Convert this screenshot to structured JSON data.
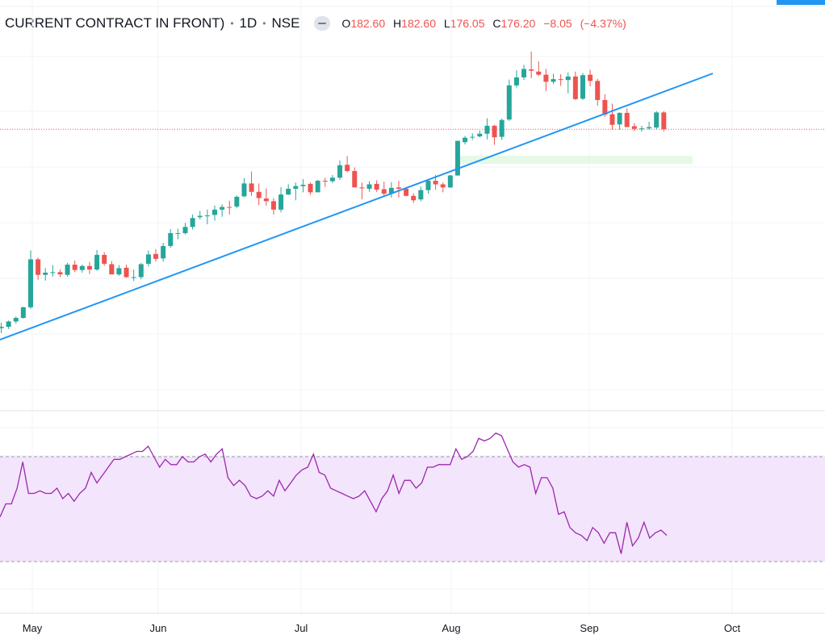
{
  "header": {
    "symbol_title": "CURRENT CONTRACT IN FRONT)",
    "interval": "1D",
    "exchange": "NSE",
    "ohlc": {
      "open_label": "O",
      "open": "182.60",
      "high_label": "H",
      "high": "182.60",
      "low_label": "L",
      "low": "176.05",
      "close_label": "C",
      "close": "176.20",
      "change": "−8.05",
      "change_pct": "(−4.37%)"
    }
  },
  "colors": {
    "up": "#26a69a",
    "down": "#ef5350",
    "trendline": "#2196f3",
    "rsi_line": "#9c27b0",
    "rsi_band": "#f3e5fb",
    "zone": "#e6f9e6",
    "grid": "#f0f3fa"
  },
  "chart_data": [
    {
      "type": "candlestick",
      "x_ticks": [
        "May",
        "Jun",
        "Jul",
        "Aug",
        "Sep",
        "Oct"
      ],
      "candles": [
        [
          119.7,
          120.9,
          118.6,
          120.0
        ],
        [
          120.0,
          121.4,
          119.5,
          121.2
        ],
        [
          121.2,
          122.3,
          120.7,
          122.0
        ],
        [
          122.0,
          124.5,
          121.8,
          124.4
        ],
        [
          124.4,
          137.2,
          124.0,
          135.2
        ],
        [
          135.2,
          135.6,
          130.6,
          131.7
        ],
        [
          131.7,
          133.2,
          130.4,
          132.2
        ],
        [
          132.2,
          133.9,
          131.3,
          132.3
        ],
        [
          132.3,
          132.9,
          131.2,
          131.8
        ],
        [
          131.7,
          134.4,
          131.3,
          134.0
        ],
        [
          134.0,
          134.9,
          132.3,
          132.8
        ],
        [
          132.8,
          134.0,
          132.2,
          133.7
        ],
        [
          133.7,
          134.6,
          131.9,
          132.9
        ],
        [
          132.9,
          137.3,
          132.6,
          136.2
        ],
        [
          136.2,
          136.8,
          133.7,
          134.2
        ],
        [
          134.1,
          134.8,
          131.8,
          131.8
        ],
        [
          131.8,
          133.9,
          131.5,
          133.2
        ],
        [
          133.3,
          134.0,
          131.0,
          131.2
        ],
        [
          131.2,
          132.9,
          130.3,
          131.2
        ],
        [
          131.2,
          134.4,
          130.7,
          134.1
        ],
        [
          134.2,
          137.2,
          133.6,
          136.3
        ],
        [
          136.4,
          137.5,
          134.7,
          135.3
        ],
        [
          135.4,
          138.9,
          134.7,
          138.2
        ],
        [
          138.2,
          142.0,
          137.8,
          141.1
        ],
        [
          141.1,
          142.1,
          139.7,
          141.1
        ],
        [
          141.1,
          143.4,
          140.8,
          142.5
        ],
        [
          142.5,
          145.3,
          141.9,
          144.5
        ],
        [
          144.7,
          146.1,
          144.2,
          145.0
        ],
        [
          145.0,
          146.4,
          143.1,
          145.1
        ],
        [
          145.2,
          147.3,
          143.9,
          146.4
        ],
        [
          146.4,
          147.6,
          144.8,
          147.0
        ],
        [
          147.0,
          148.4,
          145.3,
          146.9
        ],
        [
          147.1,
          149.6,
          146.7,
          149.3
        ],
        [
          149.4,
          153.5,
          149.2,
          152.3
        ],
        [
          152.3,
          155.0,
          149.5,
          150.4
        ],
        [
          150.4,
          152.3,
          147.4,
          149.0
        ],
        [
          148.9,
          151.2,
          147.3,
          148.3
        ],
        [
          148.3,
          149.0,
          145.3,
          146.4
        ],
        [
          146.4,
          151.5,
          145.8,
          149.8
        ],
        [
          149.8,
          152.1,
          149.7,
          151.1
        ],
        [
          151.1,
          152.5,
          148.5,
          151.7
        ],
        [
          151.7,
          153.3,
          150.3,
          152.0
        ],
        [
          152.2,
          152.5,
          149.7,
          150.3
        ],
        [
          150.3,
          153.1,
          150.4,
          152.9
        ],
        [
          152.9,
          153.6,
          151.5,
          152.8
        ],
        [
          152.8,
          154.2,
          152.4,
          153.6
        ],
        [
          153.6,
          157.5,
          153.1,
          156.4
        ],
        [
          156.5,
          158.5,
          154.8,
          155.1
        ],
        [
          155.1,
          155.9,
          151.6,
          151.4
        ],
        [
          151.4,
          152.5,
          148.7,
          151.2
        ],
        [
          151.1,
          152.8,
          150.4,
          152.1
        ],
        [
          152.2,
          153.0,
          150.4,
          150.9
        ],
        [
          151.0,
          152.7,
          149.4,
          150.0
        ],
        [
          150.0,
          152.6,
          149.1,
          151.3
        ],
        [
          151.4,
          152.9,
          149.1,
          151.1
        ],
        [
          151.1,
          151.5,
          149.4,
          149.5
        ],
        [
          149.5,
          150.1,
          147.9,
          148.5
        ],
        [
          148.7,
          151.6,
          148.3,
          150.8
        ],
        [
          150.8,
          153.1,
          150.0,
          152.9
        ],
        [
          152.9,
          154.2,
          150.9,
          152.1
        ],
        [
          152.1,
          152.5,
          150.3,
          151.4
        ],
        [
          151.4,
          154.2,
          151.3,
          154.1
        ],
        [
          154.1,
          161.9,
          154.0,
          161.9
        ],
        [
          161.6,
          163.0,
          161.1,
          162.6
        ],
        [
          162.7,
          163.6,
          162.1,
          162.8
        ],
        [
          162.9,
          164.2,
          162.7,
          163.5
        ],
        [
          163.5,
          167.0,
          162.2,
          165.3
        ],
        [
          165.3,
          165.5,
          161.0,
          162.7
        ],
        [
          162.8,
          166.9,
          162.1,
          166.6
        ],
        [
          166.7,
          175.7,
          166.4,
          174.4
        ],
        [
          174.4,
          177.8,
          173.9,
          176.2
        ],
        [
          176.2,
          179.0,
          175.6,
          178.1
        ],
        [
          178.0,
          182.0,
          176.0,
          177.7
        ],
        [
          177.5,
          179.8,
          176.5,
          176.8
        ],
        [
          176.8,
          178.1,
          173.1,
          175.2
        ],
        [
          175.2,
          177.0,
          174.7,
          175.8
        ],
        [
          175.8,
          176.9,
          174.3,
          175.6
        ],
        [
          175.6,
          177.3,
          172.6,
          176.4
        ],
        [
          176.4,
          177.5,
          171.1,
          171.3
        ],
        [
          171.4,
          177.2,
          171.1,
          176.7
        ],
        [
          176.8,
          177.9,
          174.2,
          175.4
        ],
        [
          175.4,
          175.9,
          169.8,
          171.1
        ],
        [
          171.1,
          172.4,
          167.3,
          167.8
        ],
        [
          167.9,
          170.3,
          164.4,
          165.5
        ],
        [
          165.6,
          168.3,
          164.4,
          168.2
        ],
        [
          168.2,
          169.2,
          165.1,
          165.0
        ],
        [
          165.2,
          165.9,
          164.1,
          164.6
        ],
        [
          164.6,
          165.3,
          164.0,
          164.7
        ],
        [
          164.7,
          166.2,
          164.4,
          165.0
        ],
        [
          164.9,
          168.6,
          164.5,
          168.3
        ],
        [
          168.3,
          168.6,
          164.0,
          164.5
        ]
      ]
    },
    {
      "type": "line",
      "name": "RSI",
      "band": [
        30,
        70
      ],
      "values": [
        47,
        52,
        52,
        58,
        68,
        56,
        56,
        57,
        56,
        56,
        58,
        54,
        56,
        53,
        56,
        58,
        64,
        60,
        63,
        66,
        69,
        69,
        70,
        71,
        72,
        72,
        74,
        70,
        66,
        69,
        67,
        67,
        70,
        68,
        68,
        70,
        71,
        68,
        71,
        73,
        62,
        59,
        61,
        59,
        55,
        54,
        55,
        57,
        55,
        61,
        57,
        60,
        63,
        65,
        66,
        71,
        64,
        63,
        58,
        57,
        56,
        55,
        54,
        55,
        57,
        53,
        49,
        54,
        57,
        63,
        56,
        61,
        61,
        58,
        60,
        66,
        66,
        67,
        67,
        67,
        73,
        69,
        70,
        72,
        77,
        76,
        77,
        79,
        78,
        73,
        68,
        66,
        67,
        66,
        56,
        62,
        62,
        58,
        48,
        49,
        43,
        41,
        40,
        38,
        43,
        41,
        37,
        41,
        41,
        33,
        45,
        36,
        39,
        45,
        39,
        41,
        42,
        40
      ]
    }
  ]
}
